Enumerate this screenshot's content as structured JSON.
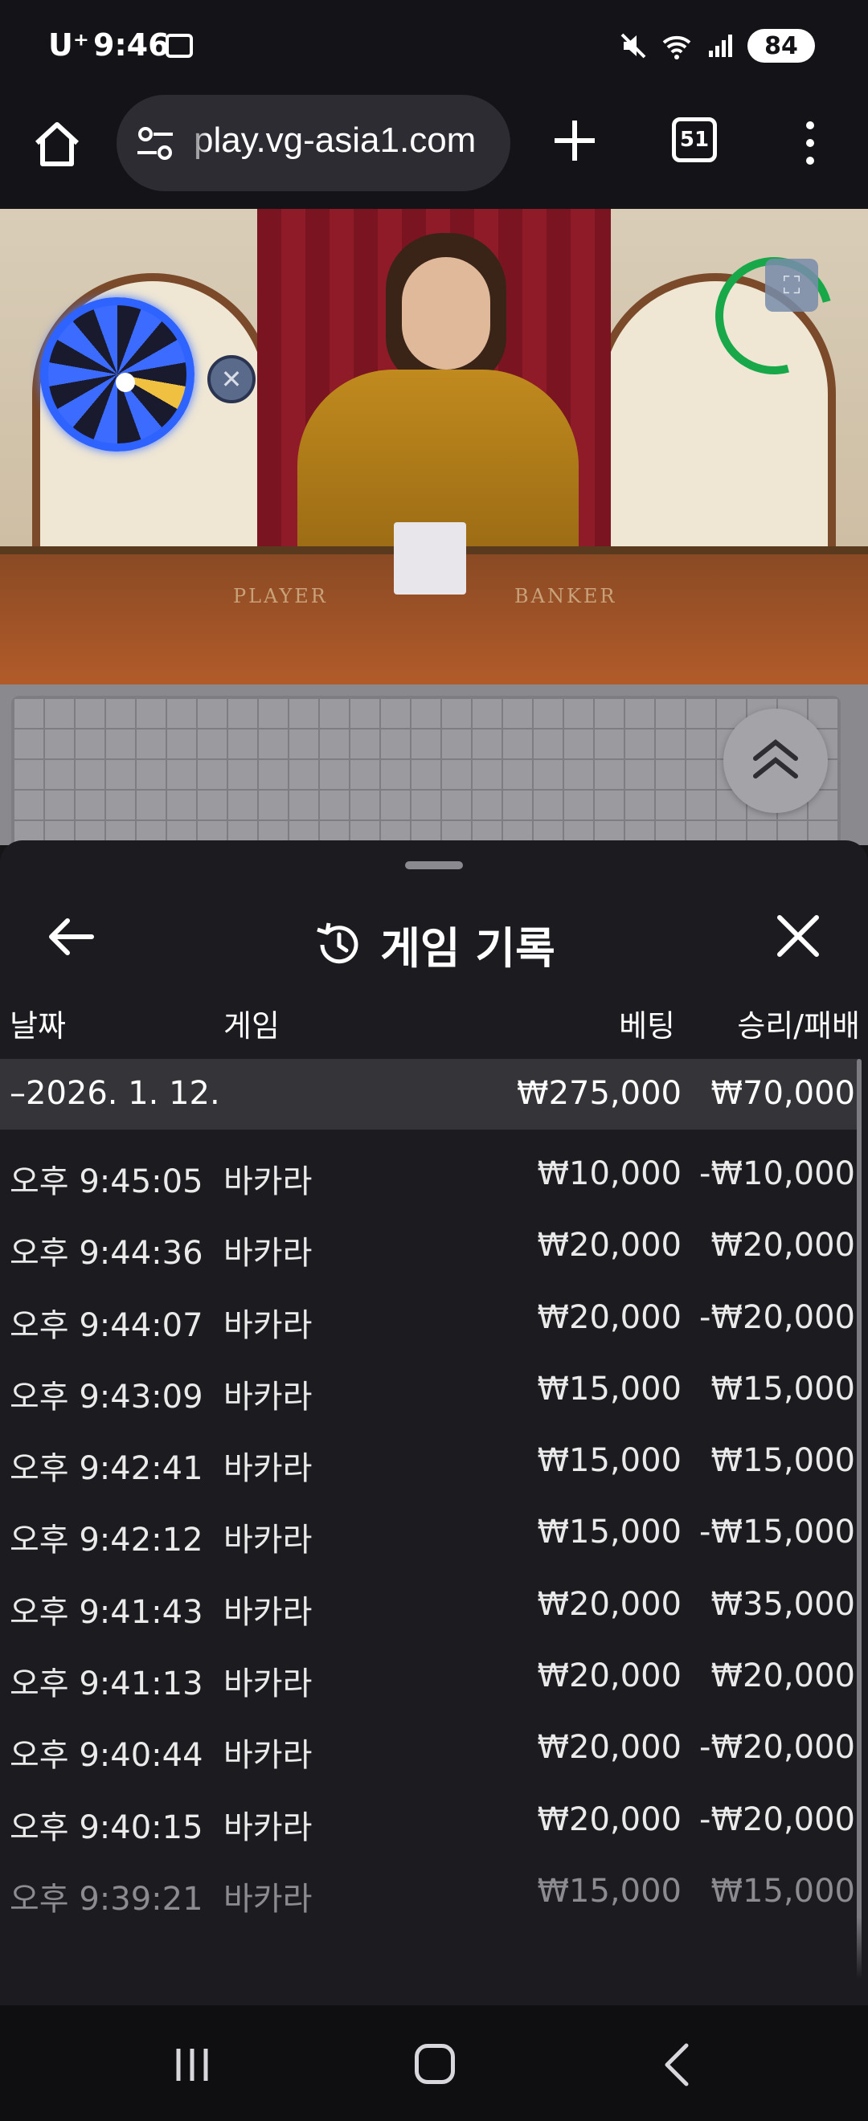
{
  "status_bar": {
    "carrier": "U⁺",
    "time": "9:46",
    "battery": "84"
  },
  "browser": {
    "url": "play.vg-asia1.com",
    "tab_count": "51"
  },
  "video": {
    "table_labels": [
      "PLAYER",
      "BANKER"
    ]
  },
  "sheet": {
    "title": "게임 기록",
    "columns": {
      "date": "날짜",
      "game": "게임",
      "bet": "베팅",
      "result": "승리/패배"
    },
    "summary": {
      "date": "–2026. 1. 12.",
      "bet": "₩275,000",
      "result": "₩70,000"
    },
    "rows": [
      {
        "time": "오후 9:45:05",
        "game": "바카라",
        "bet": "₩10,000",
        "result": "-₩10,000"
      },
      {
        "time": "오후 9:44:36",
        "game": "바카라",
        "bet": "₩20,000",
        "result": "₩20,000"
      },
      {
        "time": "오후 9:44:07",
        "game": "바카라",
        "bet": "₩20,000",
        "result": "-₩20,000"
      },
      {
        "time": "오후 9:43:09",
        "game": "바카라",
        "bet": "₩15,000",
        "result": "₩15,000"
      },
      {
        "time": "오후 9:42:41",
        "game": "바카라",
        "bet": "₩15,000",
        "result": "₩15,000"
      },
      {
        "time": "오후 9:42:12",
        "game": "바카라",
        "bet": "₩15,000",
        "result": "-₩15,000"
      },
      {
        "time": "오후 9:41:43",
        "game": "바카라",
        "bet": "₩20,000",
        "result": "₩35,000"
      },
      {
        "time": "오후 9:41:13",
        "game": "바카라",
        "bet": "₩20,000",
        "result": "₩20,000"
      },
      {
        "time": "오후 9:40:44",
        "game": "바카라",
        "bet": "₩20,000",
        "result": "-₩20,000"
      },
      {
        "time": "오후 9:40:15",
        "game": "바카라",
        "bet": "₩20,000",
        "result": "-₩20,000"
      },
      {
        "time": "오후 9:39:21",
        "game": "바카라",
        "bet": "₩15,000",
        "result": "₩15,000"
      }
    ]
  },
  "icons": {
    "home": "home-icon",
    "tune": "site-settings-icon",
    "new_tab": "plus-icon",
    "more": "more-vert-icon",
    "history": "history-icon",
    "back": "arrow-left-icon",
    "close": "close-icon",
    "collapse": "chevron-double-up-icon"
  },
  "colors": {
    "sheet_bg": "#1c1b1f",
    "summary_bg": "#353439",
    "timer_green": "#18a84a",
    "wheel_blue": "#2f63ff"
  }
}
